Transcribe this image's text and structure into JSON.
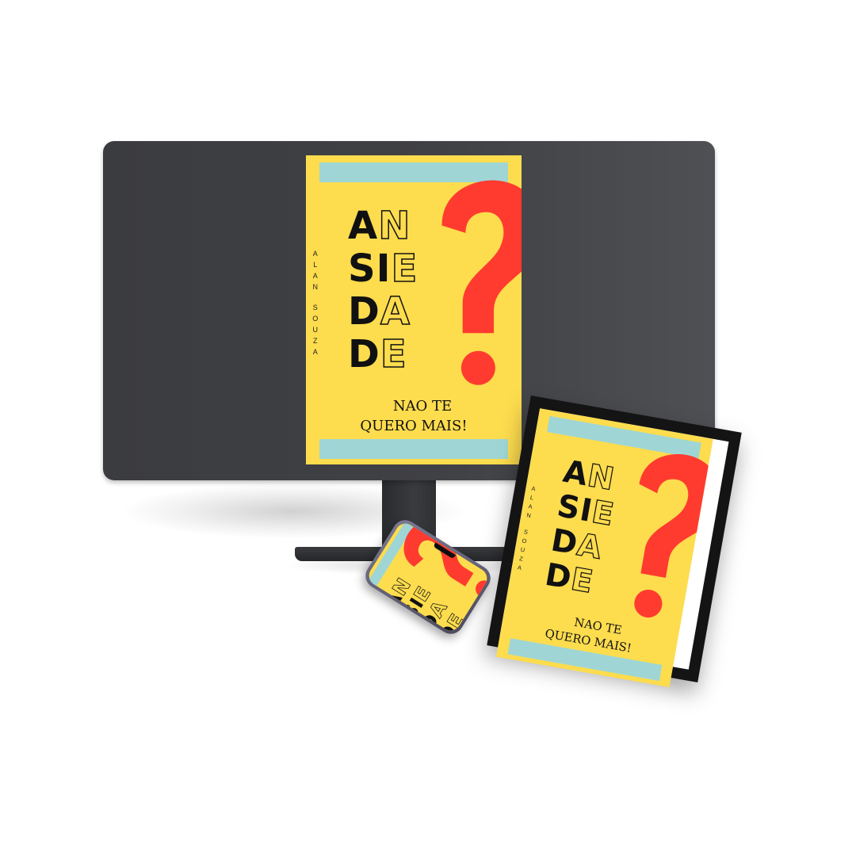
{
  "book": {
    "title_lines": [
      {
        "solid": "A",
        "outline": "N"
      },
      {
        "solid": "SI",
        "outline": "E"
      },
      {
        "solid": "D",
        "outline": "A"
      },
      {
        "solid": "D",
        "outline": "E"
      }
    ],
    "author_first": [
      "A",
      "L",
      "A",
      "N"
    ],
    "author_last": [
      "S",
      "O",
      "U",
      "Z",
      "A"
    ],
    "subtitle_line1": "NAO TE",
    "subtitle_line2": "QUERO MAIS!",
    "colors": {
      "background": "#fddc4e",
      "bands": "#9fd6d5",
      "question_mark": "#ff3b2f",
      "text": "#111111"
    }
  },
  "devices": [
    "desktop-monitor",
    "picture-frame",
    "smartphone"
  ]
}
